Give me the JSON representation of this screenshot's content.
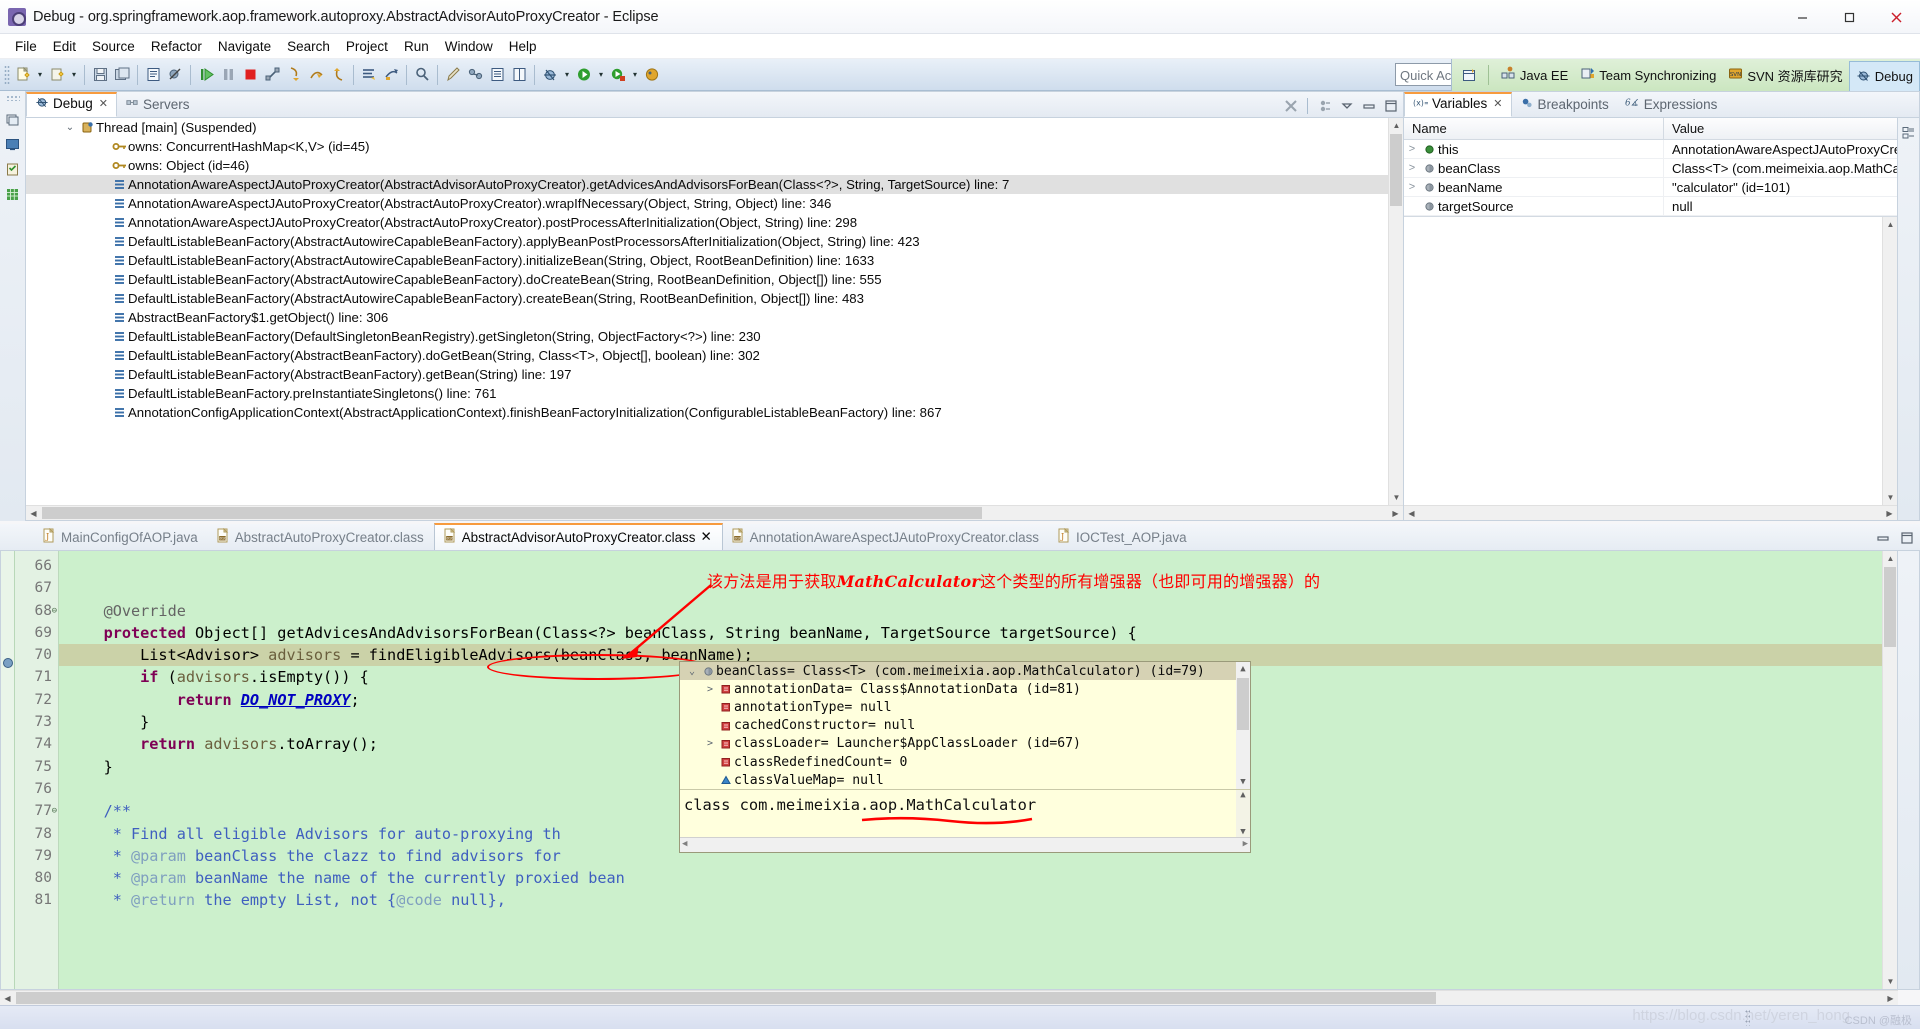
{
  "window": {
    "title": "Debug - org.springframework.aop.framework.autoproxy.AbstractAdvisorAutoProxyCreator - Eclipse",
    "icon": "eclipse-icon",
    "minimize": "minimize-button",
    "maximize": "maximize-button",
    "close": "close-button"
  },
  "menubar": {
    "items": [
      {
        "label": "File"
      },
      {
        "label": "Edit"
      },
      {
        "label": "Source"
      },
      {
        "label": "Refactor"
      },
      {
        "label": "Navigate"
      },
      {
        "label": "Search"
      },
      {
        "label": "Project"
      },
      {
        "label": "Run"
      },
      {
        "label": "Window"
      },
      {
        "label": "Help"
      }
    ]
  },
  "toolbar": {
    "quick_access_placeholder": "Quick Access",
    "quick_access_value": "Quick Access"
  },
  "perspectives": {
    "open_button": "open-perspective-button",
    "items": [
      {
        "label": "Java EE",
        "active": false
      },
      {
        "label": "Team Synchronizing",
        "active": false
      },
      {
        "label": "SVN 资源库研究",
        "active": false
      },
      {
        "label": "Debug",
        "active": true
      }
    ]
  },
  "debug_view": {
    "tabs": [
      {
        "label": "Debug",
        "active": true,
        "closable": true
      },
      {
        "label": "Servers",
        "active": false,
        "closable": false
      }
    ],
    "tree": [
      {
        "indent": 1,
        "twist": "v",
        "icon": "thread-icon",
        "label": "Thread [main] (Suspended)",
        "selected": false
      },
      {
        "indent": 2,
        "twist": "",
        "icon": "monitor-key-icon",
        "label": "owns: ConcurrentHashMap<K,V>  (id=45)",
        "selected": false
      },
      {
        "indent": 2,
        "twist": "",
        "icon": "monitor-key-icon",
        "label": "owns: Object  (id=46)",
        "selected": false
      },
      {
        "indent": 2,
        "twist": "",
        "icon": "stackframe-icon",
        "label": "AnnotationAwareAspectJAutoProxyCreator(AbstractAdvisorAutoProxyCreator).getAdvicesAndAdvisorsForBean(Class<?>, String, TargetSource) line: 7",
        "selected": true
      },
      {
        "indent": 2,
        "twist": "",
        "icon": "stackframe-icon",
        "label": "AnnotationAwareAspectJAutoProxyCreator(AbstractAutoProxyCreator).wrapIfNecessary(Object, String, Object) line: 346",
        "selected": false
      },
      {
        "indent": 2,
        "twist": "",
        "icon": "stackframe-icon",
        "label": "AnnotationAwareAspectJAutoProxyCreator(AbstractAutoProxyCreator).postProcessAfterInitialization(Object, String) line: 298",
        "selected": false
      },
      {
        "indent": 2,
        "twist": "",
        "icon": "stackframe-icon",
        "label": "DefaultListableBeanFactory(AbstractAutowireCapableBeanFactory).applyBeanPostProcessorsAfterInitialization(Object, String) line: 423",
        "selected": false
      },
      {
        "indent": 2,
        "twist": "",
        "icon": "stackframe-icon",
        "label": "DefaultListableBeanFactory(AbstractAutowireCapableBeanFactory).initializeBean(String, Object, RootBeanDefinition) line: 1633",
        "selected": false
      },
      {
        "indent": 2,
        "twist": "",
        "icon": "stackframe-icon",
        "label": "DefaultListableBeanFactory(AbstractAutowireCapableBeanFactory).doCreateBean(String, RootBeanDefinition, Object[]) line: 555",
        "selected": false
      },
      {
        "indent": 2,
        "twist": "",
        "icon": "stackframe-icon",
        "label": "DefaultListableBeanFactory(AbstractAutowireCapableBeanFactory).createBean(String, RootBeanDefinition, Object[]) line: 483",
        "selected": false
      },
      {
        "indent": 2,
        "twist": "",
        "icon": "stackframe-icon",
        "label": "AbstractBeanFactory$1.getObject() line: 306",
        "selected": false
      },
      {
        "indent": 2,
        "twist": "",
        "icon": "stackframe-icon",
        "label": "DefaultListableBeanFactory(DefaultSingletonBeanRegistry).getSingleton(String, ObjectFactory<?>) line: 230",
        "selected": false
      },
      {
        "indent": 2,
        "twist": "",
        "icon": "stackframe-icon",
        "label": "DefaultListableBeanFactory(AbstractBeanFactory).doGetBean(String, Class<T>, Object[], boolean) line: 302",
        "selected": false
      },
      {
        "indent": 2,
        "twist": "",
        "icon": "stackframe-icon",
        "label": "DefaultListableBeanFactory(AbstractBeanFactory).getBean(String) line: 197",
        "selected": false
      },
      {
        "indent": 2,
        "twist": "",
        "icon": "stackframe-icon",
        "label": "DefaultListableBeanFactory.preInstantiateSingletons() line: 761",
        "selected": false
      },
      {
        "indent": 2,
        "twist": "",
        "icon": "stackframe-icon",
        "label": "AnnotationConfigApplicationContext(AbstractApplicationContext).finishBeanFactoryInitialization(ConfigurableListableBeanFactory) line: 867",
        "selected": false
      }
    ]
  },
  "variables_view": {
    "tabs": [
      {
        "label": "Variables",
        "active": true,
        "closable": true
      },
      {
        "label": "Breakpoints",
        "active": false,
        "closable": false
      },
      {
        "label": "Expressions",
        "active": false,
        "closable": false
      }
    ],
    "columns": [
      "Name",
      "Value"
    ],
    "rows": [
      {
        "twist": ">",
        "icon": "object-green-icon",
        "name": "this",
        "value": "AnnotationAwareAspectJAutoProxyCre..."
      },
      {
        "twist": ">",
        "icon": "object-gray-icon",
        "name": "beanClass",
        "value": "Class<T> (com.meimeixia.aop.MathCal..."
      },
      {
        "twist": ">",
        "icon": "object-gray-icon",
        "name": "beanName",
        "value": "\"calculator\" (id=101)"
      },
      {
        "twist": "",
        "icon": "object-gray-icon",
        "name": "targetSource",
        "value": "null"
      }
    ]
  },
  "editor": {
    "tabs": [
      {
        "label": "MainConfigOfAOP.java",
        "icon": "java-file-icon",
        "active": false,
        "closable": false
      },
      {
        "label": "AbstractAutoProxyCreator.class",
        "icon": "class-file-icon",
        "active": false,
        "closable": false
      },
      {
        "label": "AbstractAdvisorAutoProxyCreator.class",
        "icon": "class-file-icon",
        "active": true,
        "closable": true
      },
      {
        "label": "AnnotationAwareAspectJAutoProxyCreator.class",
        "icon": "class-file-icon",
        "active": false,
        "closable": false
      },
      {
        "label": "IOCTest_AOP.java",
        "icon": "java-file-icon",
        "active": false,
        "closable": false
      }
    ],
    "first_line": 66,
    "lines": [
      {
        "n": 66,
        "fold": false,
        "text": "",
        "highlight": false
      },
      {
        "n": 67,
        "fold": false,
        "text": "",
        "highlight": false
      },
      {
        "n": 68,
        "fold": true,
        "text": "    @Override",
        "highlight": false
      },
      {
        "n": 69,
        "fold": false,
        "text": "    protected Object[] getAdvicesAndAdvisorsForBean(Class<?> beanClass, String beanName, TargetSource targetSource) {",
        "highlight": false
      },
      {
        "n": 70,
        "fold": false,
        "text": "        List<Advisor> advisors = findEligibleAdvisors(beanClass, beanName);",
        "highlight": true
      },
      {
        "n": 71,
        "fold": false,
        "text": "        if (advisors.isEmpty()) {",
        "highlight": false
      },
      {
        "n": 72,
        "fold": false,
        "text": "            return DO_NOT_PROXY;",
        "highlight": false
      },
      {
        "n": 73,
        "fold": false,
        "text": "        }",
        "highlight": false
      },
      {
        "n": 74,
        "fold": false,
        "text": "        return advisors.toArray();",
        "highlight": false
      },
      {
        "n": 75,
        "fold": false,
        "text": "    }",
        "highlight": false
      },
      {
        "n": 76,
        "fold": false,
        "text": "",
        "highlight": false
      },
      {
        "n": 77,
        "fold": true,
        "text": "    /**",
        "highlight": false
      },
      {
        "n": 78,
        "fold": false,
        "text": "     * Find all eligible Advisors for auto-proxying th",
        "highlight": false
      },
      {
        "n": 79,
        "fold": false,
        "text": "     * @param beanClass the clazz to find advisors for",
        "highlight": false
      },
      {
        "n": 80,
        "fold": false,
        "text": "     * @param beanName the name of the currently proxied bean",
        "highlight": false
      },
      {
        "n": 81,
        "fold": false,
        "text": "     * @return the empty List, not {@code null},",
        "highlight": false
      }
    ],
    "annotation": {
      "prefix": "该方法是用于获取",
      "emphasis": "MathCalculator",
      "suffix": "这个类型的所有增强器（也即可用的增强器）的",
      "color": "#ff0000"
    }
  },
  "popup": {
    "rows": [
      {
        "twist": "v",
        "icon": "object-gray-icon",
        "label": "beanClass= Class<T> (com.meimeixia.aop.MathCalculator) (id=79)",
        "selected": true,
        "indent": 0
      },
      {
        "twist": ">",
        "icon": "field-red-icon",
        "label": "annotationData= Class$AnnotationData  (id=81)",
        "selected": false,
        "indent": 1
      },
      {
        "twist": "",
        "icon": "field-red-icon",
        "label": "annotationType= null",
        "selected": false,
        "indent": 1
      },
      {
        "twist": "",
        "icon": "field-red-icon",
        "label": "cachedConstructor= null",
        "selected": false,
        "indent": 1
      },
      {
        "twist": ">",
        "icon": "field-red-icon",
        "label": "classLoader= Launcher$AppClassLoader  (id=67)",
        "selected": false,
        "indent": 1
      },
      {
        "twist": "",
        "icon": "field-red-icon",
        "label": "classRedefinedCount= 0",
        "selected": false,
        "indent": 1
      },
      {
        "twist": "",
        "icon": "field-blue-icon",
        "label": "classValueMap= null",
        "selected": false,
        "indent": 1
      }
    ],
    "detail": "class com.meimeixia.aop.MathCalculator"
  },
  "statusbar": {
    "watermark": "https://blog.csdn.net/yeren_hong",
    "watermark_badge": "CSDN @融极"
  },
  "colors": {
    "accent": "#f79b3e",
    "selection": "#e0e0e0",
    "editor_bg": "#ccf0cc",
    "popup_bg": "#ffffdd",
    "annotation": "#ff0000",
    "perspective_bg": "#cbe6c0"
  }
}
